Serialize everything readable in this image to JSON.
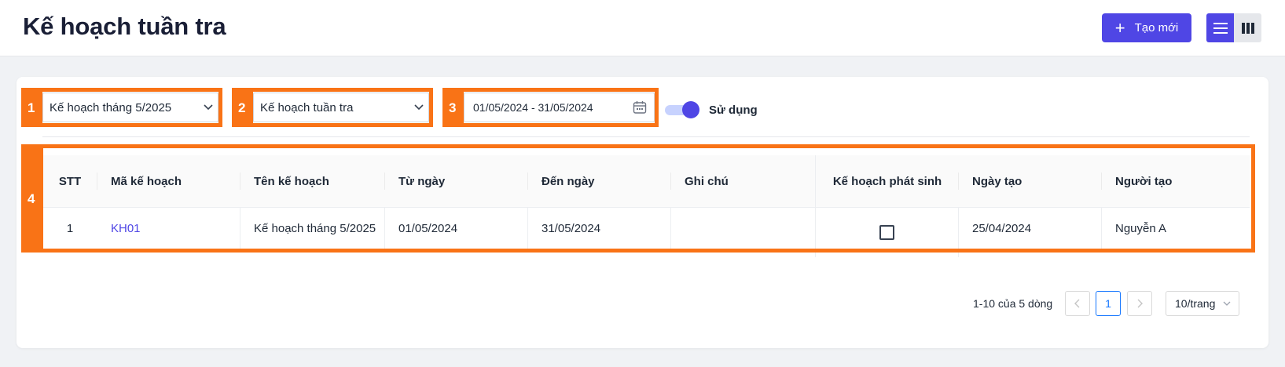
{
  "header": {
    "title": "Kế hoạch tuần tra",
    "create_label": "Tạo mới",
    "view_icons": [
      "list-view-icon",
      "column-view-icon"
    ]
  },
  "annotations": [
    "1",
    "2",
    "3",
    "4"
  ],
  "filters": {
    "plan_month": "Kế hoạch tháng 5/2025",
    "plan_type": "Kế hoạch tuần tra",
    "date_range": "01/05/2024 - 31/05/2024",
    "toggle_label": "Sử dụng",
    "toggle_on": true
  },
  "table": {
    "columns": [
      "STT",
      "Mã kế hoạch",
      "Tên kế hoạch",
      "Từ ngày",
      "Đến ngày",
      "Ghi chú",
      "Kế hoạch phát sinh",
      "Ngày tạo",
      "Người tạo"
    ],
    "rows": [
      {
        "stt": "1",
        "code": "KH01",
        "name": "Kế hoạch tháng 5/2025",
        "from": "01/05/2024",
        "to": "31/05/2024",
        "note": "",
        "extra_plan": false,
        "created": "25/04/2024",
        "creator": "Nguyễn A"
      }
    ]
  },
  "pagination": {
    "info": "1-10 của 5 dòng",
    "current_page": "1",
    "page_size": "10/trang"
  },
  "colors": {
    "accent": "#4f46e5",
    "annotation": "#f97316"
  }
}
